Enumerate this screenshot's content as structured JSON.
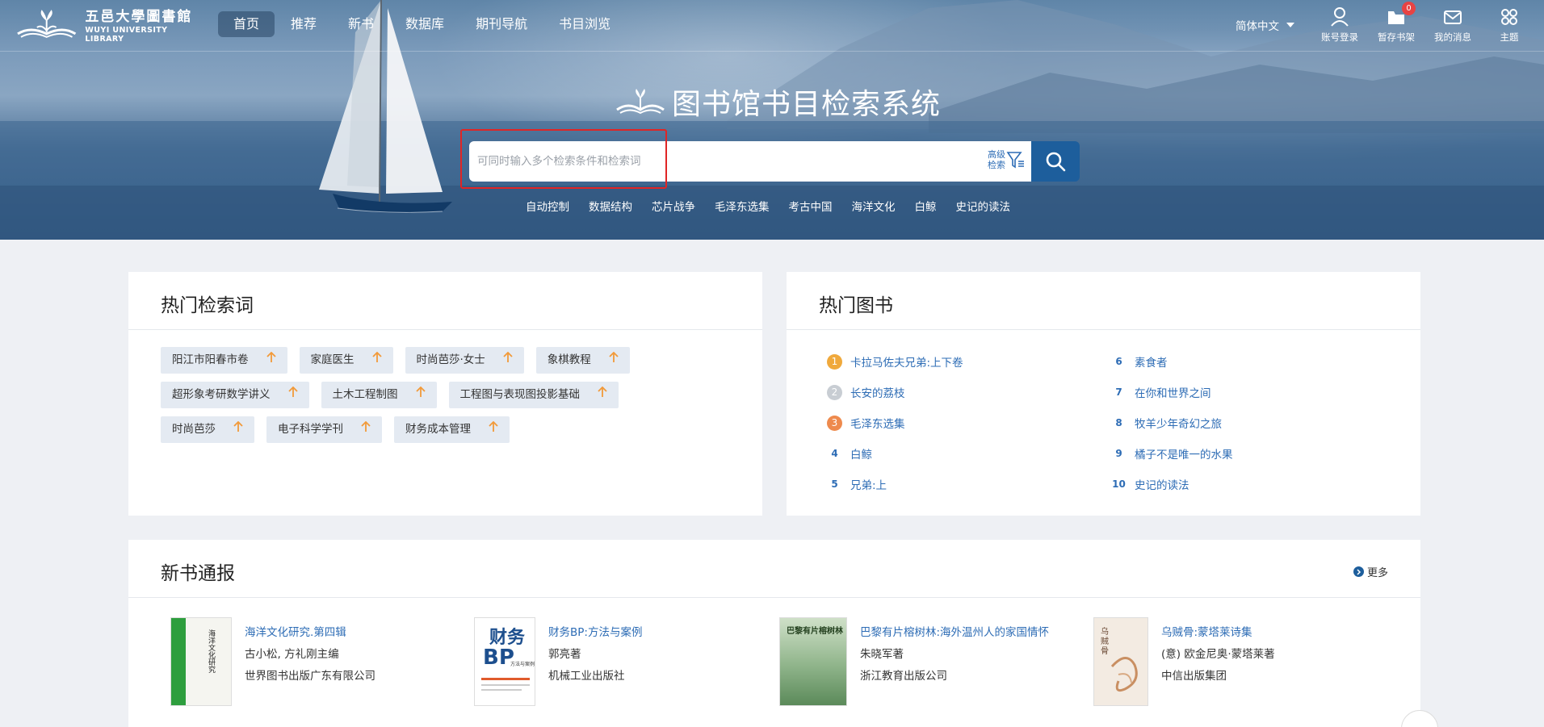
{
  "brand": {
    "cn_name": "五邑大學圖書館",
    "en_name": "WUYI UNIVERSITY LIBRARY"
  },
  "nav": {
    "items": [
      {
        "label": "首页",
        "active": true
      },
      {
        "label": "推荐",
        "active": false
      },
      {
        "label": "新书",
        "active": false
      },
      {
        "label": "数据库",
        "active": false
      },
      {
        "label": "期刊导航",
        "active": false
      },
      {
        "label": "书目浏览",
        "active": false
      }
    ]
  },
  "language": {
    "selected": "简体中文"
  },
  "tools": {
    "login": "账号登录",
    "shelf": "暂存书架",
    "shelf_count": "0",
    "messages": "我的消息",
    "theme": "主题"
  },
  "hero": {
    "title": "图书馆书目检索系统",
    "search_placeholder": "可同时输入多个检索条件和检索词",
    "search_value": "",
    "advanced_line1": "高级",
    "advanced_line2": "检索",
    "hot_words": [
      "自动控制",
      "数据结构",
      "芯片战争",
      "毛泽东选集",
      "考古中国",
      "海洋文化",
      "白鲸",
      "史记的读法"
    ]
  },
  "hot_search": {
    "title": "热门检索词",
    "rows": [
      [
        "阳江市阳春市卷",
        "家庭医生",
        "时尚芭莎·女士",
        "象棋教程"
      ],
      [
        "超形象考研数学讲义",
        "土木工程制图",
        "工程图与表现图投影基础"
      ],
      [
        "时尚芭莎",
        "电子科学学刊",
        "财务成本管理"
      ]
    ]
  },
  "hot_books": {
    "title": "热门图书",
    "left": [
      {
        "rank": "1",
        "title": "卡拉马佐夫兄弟:上下卷",
        "medal": "gold"
      },
      {
        "rank": "2",
        "title": "长安的荔枝",
        "medal": "silver"
      },
      {
        "rank": "3",
        "title": "毛泽东选集",
        "medal": "bronze"
      },
      {
        "rank": "4",
        "title": "白鲸",
        "medal": ""
      },
      {
        "rank": "5",
        "title": "兄弟:上",
        "medal": ""
      }
    ],
    "right": [
      {
        "rank": "6",
        "title": "素食者"
      },
      {
        "rank": "7",
        "title": "在你和世界之间"
      },
      {
        "rank": "8",
        "title": "牧羊少年奇幻之旅"
      },
      {
        "rank": "9",
        "title": "橘子不是唯一的水果"
      },
      {
        "rank": "10",
        "title": "史记的读法"
      }
    ]
  },
  "new_books": {
    "title": "新书通报",
    "more": "更多",
    "items": [
      {
        "title": "海洋文化研究.第四辑",
        "author": "古小松, 方礼刚主编",
        "publisher": "世界图书出版广东有限公司"
      },
      {
        "title": "财务BP:方法与案例",
        "author": "郭亮著",
        "publisher": "机械工业出版社"
      },
      {
        "title": "巴黎有片榕树林:海外温州人的家国情怀",
        "author": "朱晓军著",
        "publisher": "浙江教育出版公司"
      },
      {
        "title": "乌贼骨:蒙塔莱诗集",
        "author": "(意) 欧金尼奥·蒙塔莱著",
        "publisher": "中信出版集团"
      }
    ],
    "cover_texts": [
      "海洋文化研究",
      "财务",
      "BP",
      "方法与案例",
      "巴黎有片榕树林",
      "乌贼骨"
    ]
  }
}
